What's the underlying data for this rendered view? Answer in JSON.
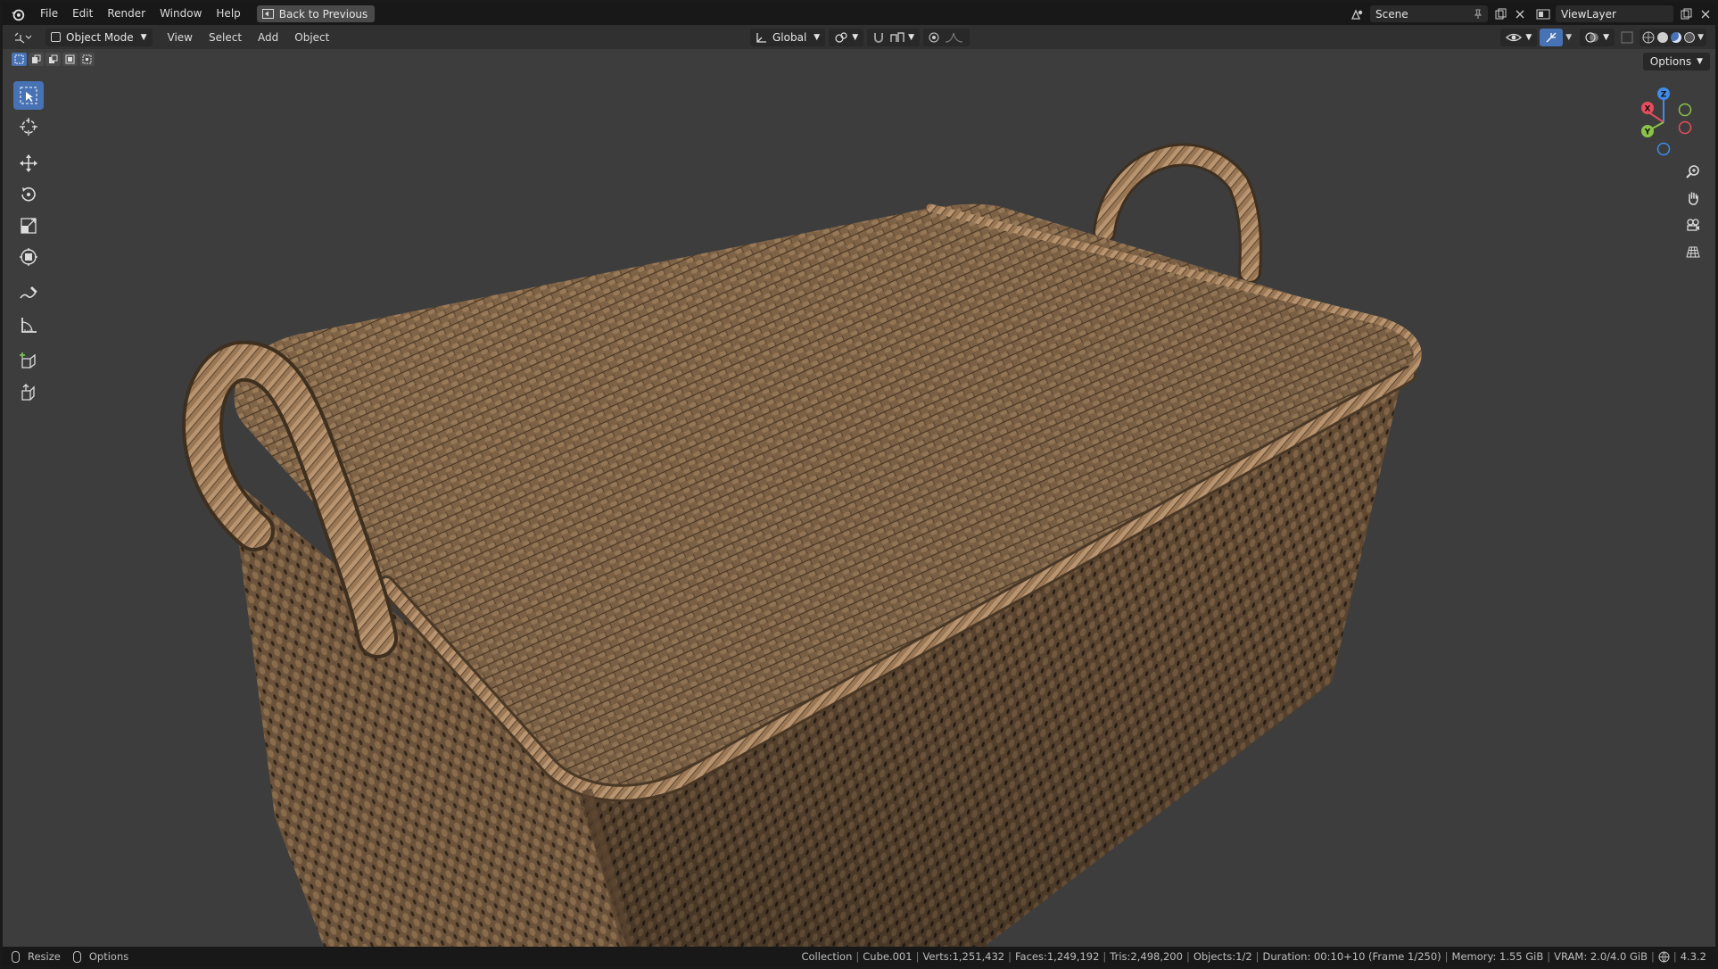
{
  "topbar": {
    "menus": [
      "File",
      "Edit",
      "Render",
      "Window",
      "Help"
    ],
    "back_label": "Back to Previous",
    "scene": "Scene",
    "view_layer": "ViewLayer"
  },
  "header": {
    "mode": "Object Mode",
    "menus": [
      "View",
      "Select",
      "Add",
      "Object"
    ],
    "orientation": "Global",
    "options_label": "Options"
  },
  "viewport": {
    "background": "#3d3d3d",
    "object_color": "#7a6044"
  },
  "toolbar": {
    "tools": [
      "select-box",
      "cursor",
      "move",
      "rotate",
      "scale",
      "transform",
      "annotate",
      "measure",
      "add-cube",
      "extrude"
    ],
    "active": "select-box"
  },
  "gizmo": {
    "axes": [
      "X",
      "Y",
      "Z"
    ],
    "colors": {
      "x": "#e84d5e",
      "y": "#8bc34a",
      "z": "#3f8ce8"
    }
  },
  "statusbar": {
    "left": [
      "Resize",
      "Options"
    ],
    "right": {
      "collection": "Collection",
      "object": "Cube.001",
      "verts": "Verts:1,251,432",
      "faces": "Faces:1,249,192",
      "tris": "Tris:2,498,200",
      "objects": "Objects:1/2",
      "duration": "Duration: 00:10+10 (Frame 1/250)",
      "memory": "Memory: 1.55 GiB",
      "vram": "VRAM: 2.0/4.0 GiB",
      "version": "4.3.2"
    }
  }
}
